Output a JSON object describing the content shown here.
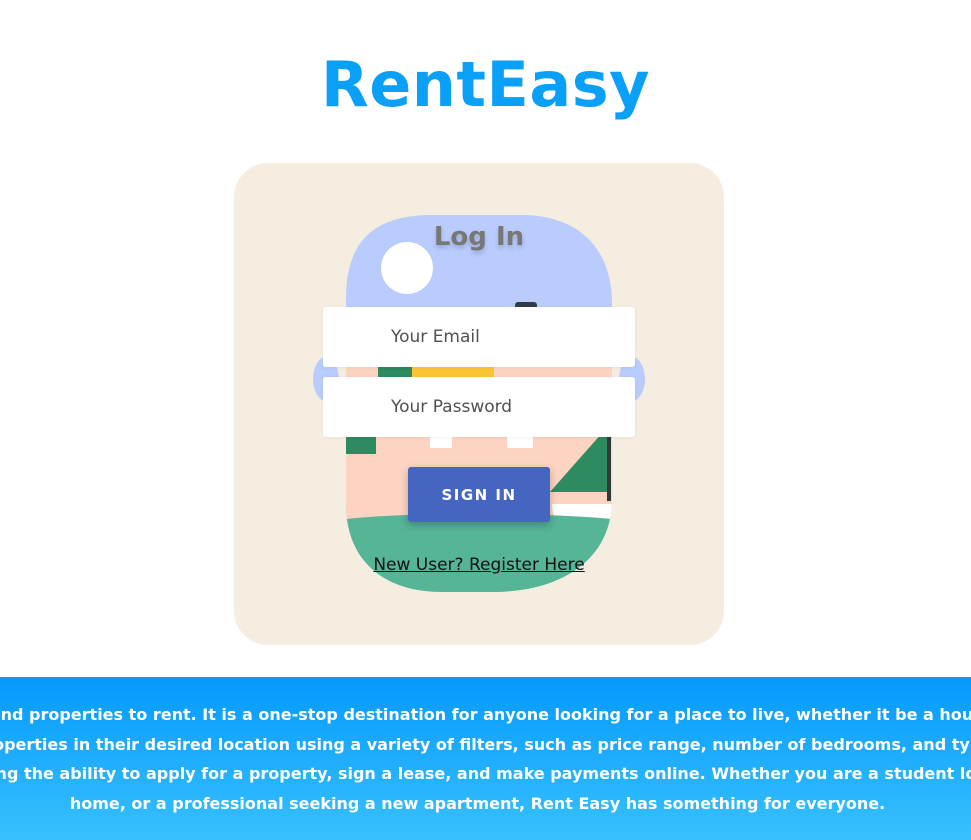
{
  "brand": {
    "name": "RentEasy"
  },
  "login": {
    "title": "Log In",
    "email_placeholder": "Your Email",
    "password_placeholder": "Your Password",
    "signin_label": "SIGN IN",
    "register_link": "New User? Register Here"
  },
  "footer": {
    "lines": [
      "e find properties to rent. It is a one-stop destination for anyone looking for a place to live, whether it be a hous",
      "properties in their desired location using a variety of filters, such as price range, number of bedrooms, and typ",
      "ding the ability to apply for a property, sign a lease, and make payments online. Whether you are a student lo",
      "home, or a professional seeking a new apartment, Rent Easy has something for everyone."
    ]
  },
  "colors": {
    "brand": "#0aa0f7",
    "card_background": "#f5eee0",
    "signin_button": "#4466c0",
    "footer_gradient_top": "#0599fd",
    "footer_gradient_bottom": "#38c1fd"
  }
}
